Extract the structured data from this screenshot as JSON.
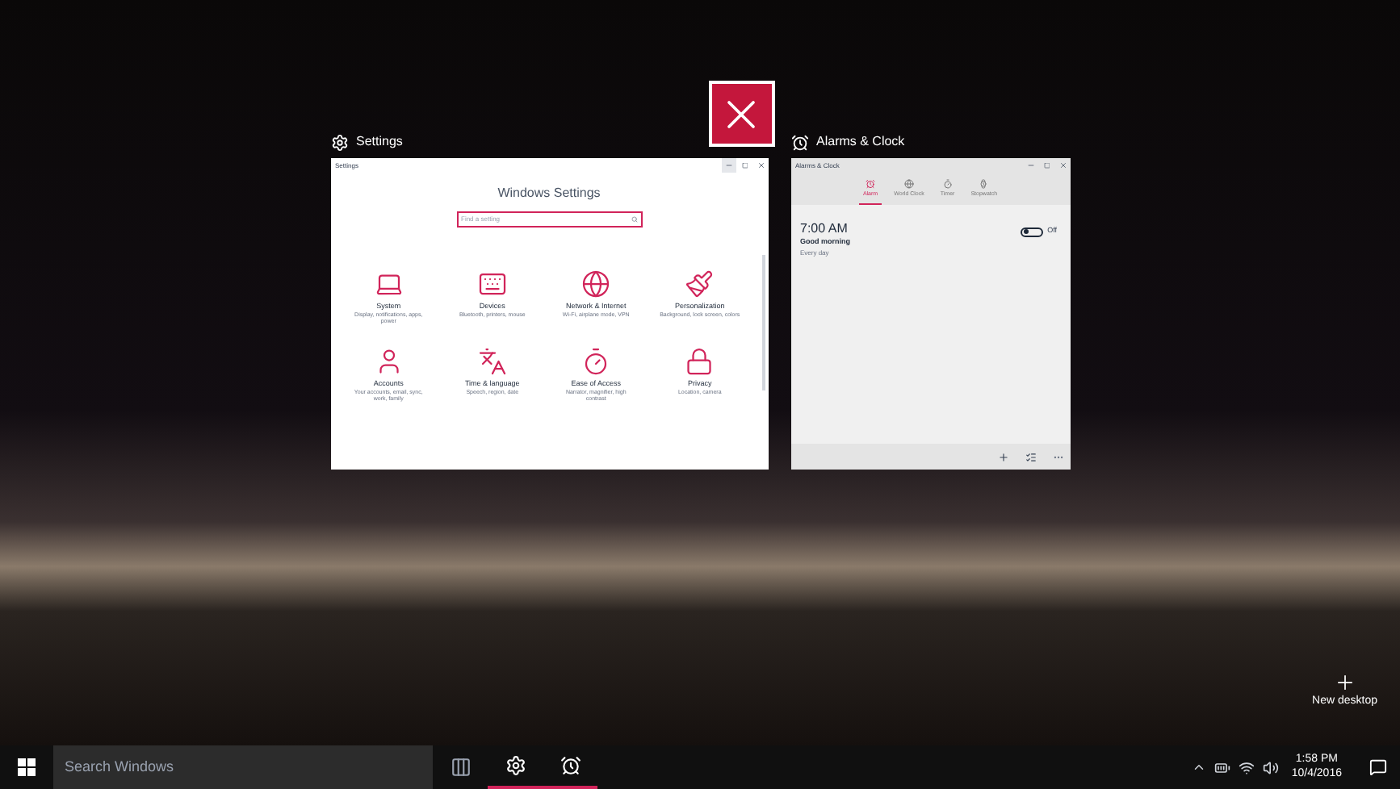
{
  "windows": [
    {
      "kind": "settings",
      "label": "Settings",
      "title": "Settings",
      "hovered": true,
      "heading": "Windows Settings",
      "search": {
        "placeholder": "Find a setting"
      },
      "items": [
        {
          "kind": "system",
          "title": "System",
          "description": "Display, notifications, apps, power"
        },
        {
          "kind": "devices",
          "title": "Devices",
          "description": "Bluetooth, printers, mouse"
        },
        {
          "kind": "network",
          "title": "Network & Internet",
          "description": "Wi-Fi, airplane mode, VPN"
        },
        {
          "kind": "personalization",
          "title": "Personalization",
          "description": "Background, lock screen, colors"
        },
        {
          "kind": "accounts",
          "title": "Accounts",
          "description": "Your accounts, email, sync, work, family"
        },
        {
          "kind": "time",
          "title": "Time & language",
          "description": "Speech, region, date"
        },
        {
          "kind": "ease",
          "title": "Ease of Access",
          "description": "Narrator, magnifier, high contrast"
        },
        {
          "kind": "privacy",
          "title": "Privacy",
          "description": "Location, camera"
        }
      ]
    },
    {
      "kind": "alarms",
      "label": "Alarms & Clock",
      "title": "Alarms & Clock",
      "hovered": false,
      "tabs": [
        {
          "kind": "alarm",
          "label": "Alarm",
          "selected": true
        },
        {
          "kind": "world",
          "label": "World Clock",
          "selected": false
        },
        {
          "kind": "timer",
          "label": "Timer",
          "selected": false
        },
        {
          "kind": "stopwatch",
          "label": "Stopwatch",
          "selected": false
        }
      ],
      "alarms": [
        {
          "time": "7:00 AM",
          "name": "Good morning",
          "repeat": "Every day",
          "on": false,
          "state_label": "Off"
        }
      ]
    }
  ],
  "new_desktop": {
    "label": "New desktop"
  },
  "taskbar": {
    "search": {
      "placeholder": "Search Windows"
    },
    "apps": [
      {
        "kind": "settings"
      },
      {
        "kind": "alarms"
      }
    ],
    "clock": {
      "time": "1:58 PM",
      "date": "10/4/2016"
    }
  }
}
